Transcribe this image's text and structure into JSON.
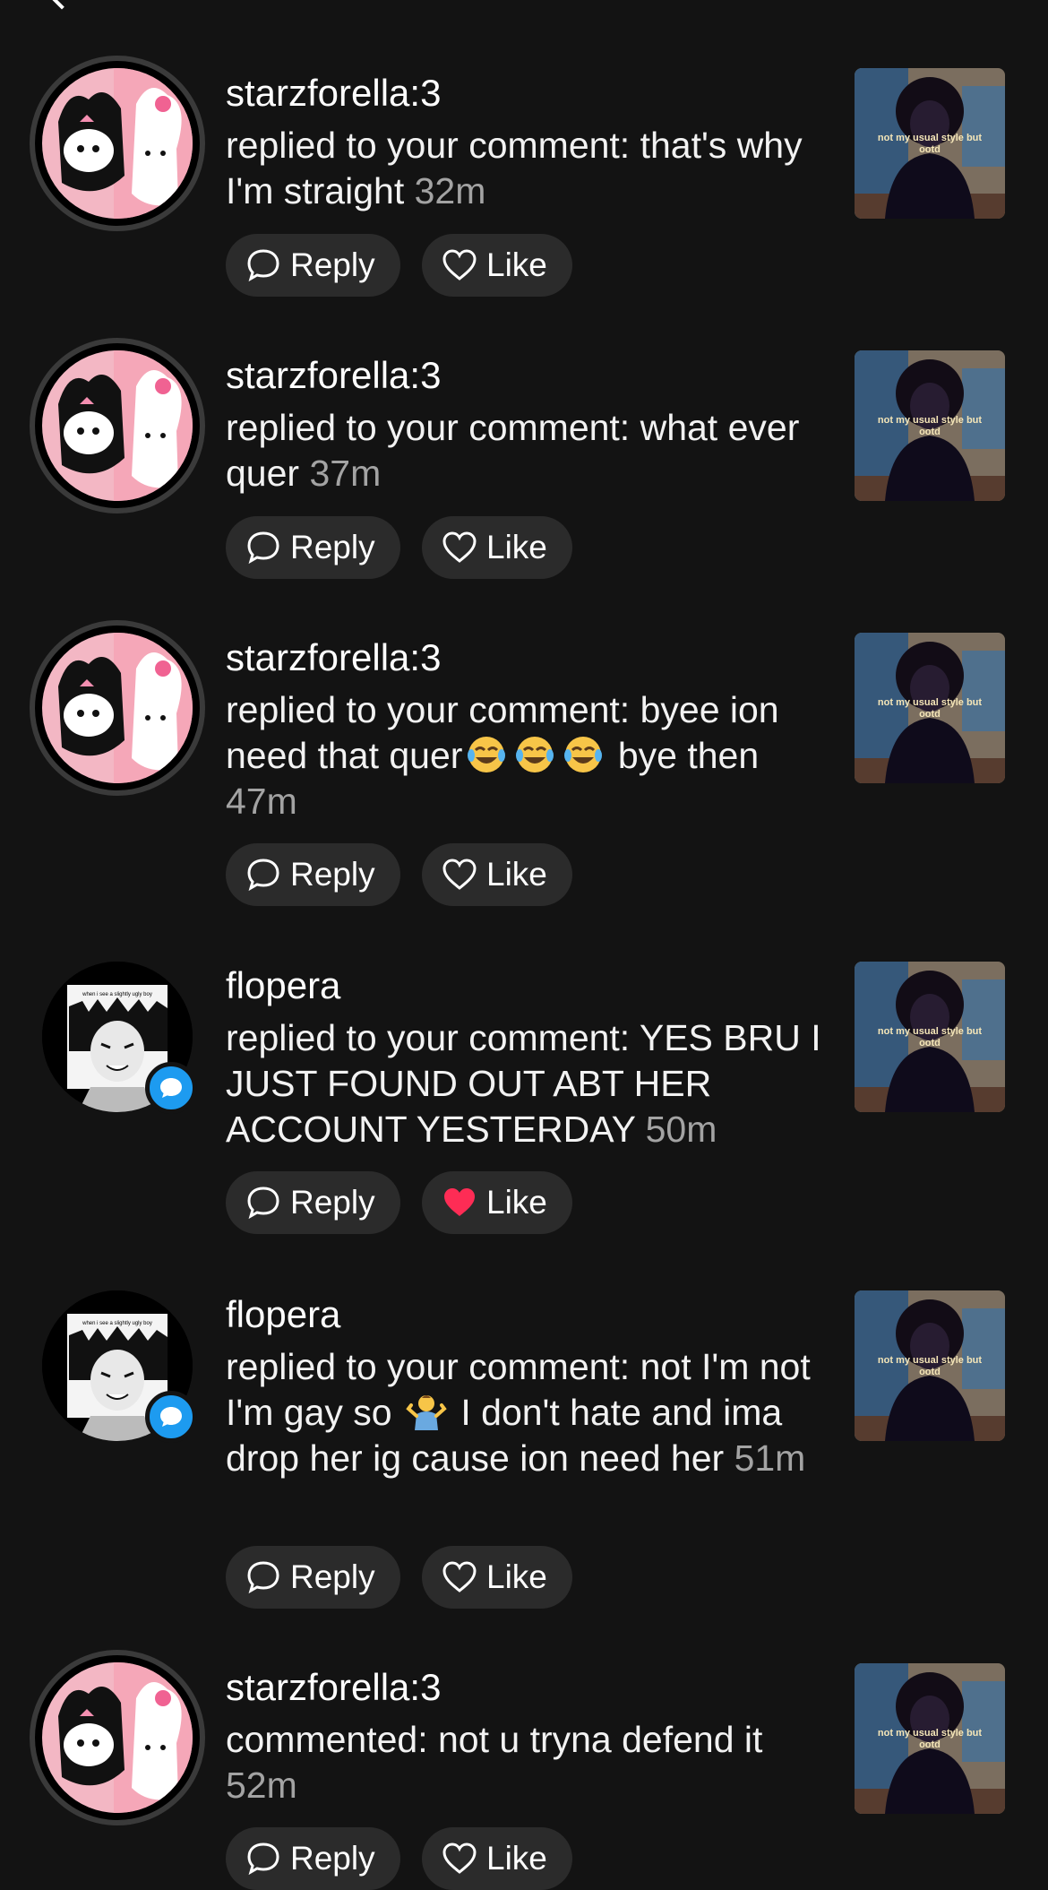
{
  "notifications": [
    {
      "username": "starzforella:3",
      "message": "replied to your comment: that's why I'm straight",
      "time": "32m",
      "avatar": "kuromi-melody",
      "liked": false
    },
    {
      "username": "starzforella:3",
      "message": "replied to your comment: what ever quer",
      "time": "37m",
      "avatar": "kuromi-melody",
      "liked": false
    },
    {
      "username": "starzforella:3",
      "message_before": "replied to your comment: byee ion need that quer",
      "emoji": "face-with-tears-of-joy",
      "message_after": " bye then",
      "time": "47m",
      "avatar": "kuromi-melody",
      "liked": false
    },
    {
      "username": "flopera",
      "message": "replied to your comment: YES BRU I JUST FOUND OUT ABT HER ACCOUNT YESTERDAY",
      "time": "50m",
      "avatar": "manga-boy",
      "avatar_caption": "when i see a slightly ugly boy",
      "liked": true
    },
    {
      "username": "flopera",
      "message_before": "replied to your comment: not I'm not I'm gay so",
      "emoji": "person-shrugging",
      "message_after": " I don't hate and ima drop her ig cause ion need her",
      "time": "51m",
      "avatar": "manga-boy",
      "avatar_caption": "when i see a slightly ugly boy",
      "liked": false
    },
    {
      "username": "starzforella:3",
      "message": "commented: not u tryna defend it",
      "time": "52m",
      "avatar": "kuromi-melody",
      "liked": false
    }
  ],
  "buttons": {
    "reply": "Reply",
    "like": "Like"
  },
  "video_thumbnail": {
    "caption_line1": "not my usual style but",
    "caption_line2": "ootd"
  },
  "colors": {
    "background": "#131313",
    "like_active": "#fe2c55",
    "badge": "#1d9bf0",
    "time": "#a3a3a3"
  }
}
